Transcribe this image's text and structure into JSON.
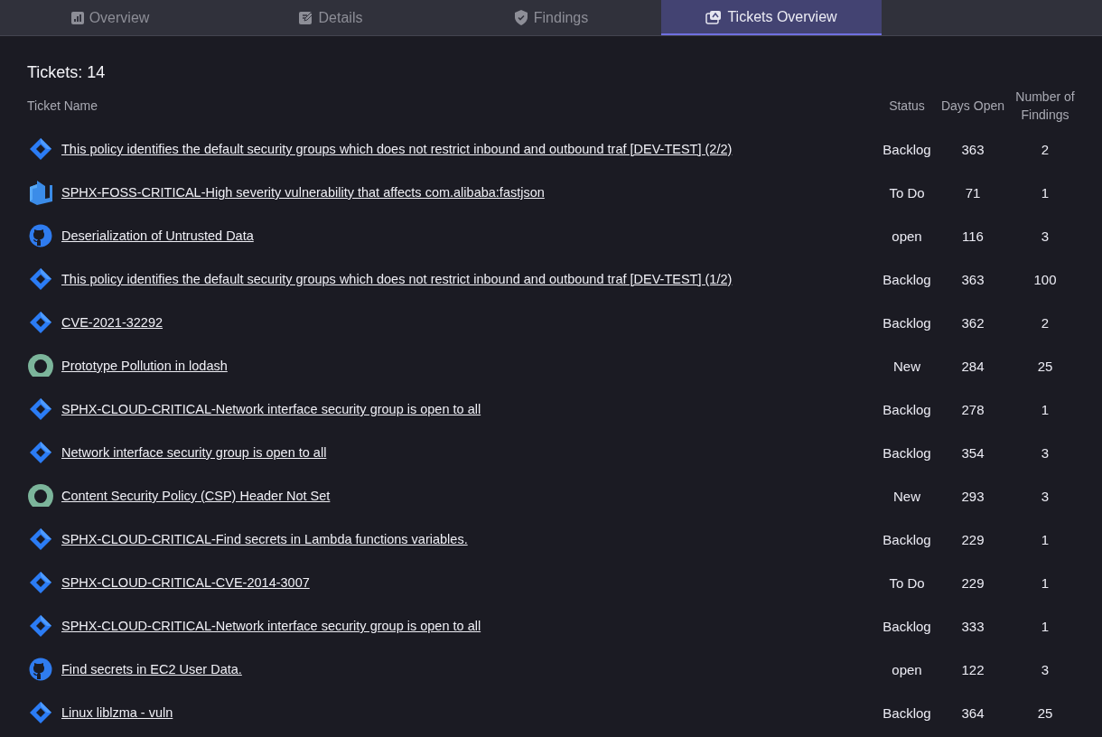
{
  "tabs": [
    {
      "label": "Overview",
      "kind": "chart",
      "selected": false
    },
    {
      "label": "Details",
      "kind": "edit",
      "selected": false
    },
    {
      "label": "Findings",
      "kind": "shield",
      "selected": false
    },
    {
      "label": "Tickets Overview",
      "kind": "tickets",
      "selected": true
    }
  ],
  "title": "Tickets: 14",
  "table": {
    "columns": [
      "Ticket Name",
      "Status",
      "Days Open",
      "Number of Findings"
    ],
    "rows": [
      {
        "kind": "diamond",
        "name": "This policy identifies the default security groups which does not restrict inbound and outbound traf [DEV-TEST] (2/2)",
        "status": "Backlog",
        "days_open": "363",
        "findings": "2"
      },
      {
        "kind": "azure",
        "name": "SPHX-FOSS-CRITICAL-High severity vulnerability that affects com.alibaba:fastjson",
        "status": "To Do",
        "days_open": "71",
        "findings": "1"
      },
      {
        "kind": "github",
        "name": "Deserialization of Untrusted Data",
        "status": "open",
        "days_open": "116",
        "findings": "3"
      },
      {
        "kind": "diamond",
        "name": "This policy identifies the default security groups which does not restrict inbound and outbound traf [DEV-TEST] (1/2)",
        "status": "Backlog",
        "days_open": "363",
        "findings": "100"
      },
      {
        "kind": "diamond",
        "name": "CVE-2021-32292",
        "status": "Backlog",
        "days_open": "362",
        "findings": "2"
      },
      {
        "kind": "ring",
        "name": "Prototype Pollution in lodash",
        "status": "New",
        "days_open": "284",
        "findings": "25"
      },
      {
        "kind": "diamond",
        "name": "SPHX-CLOUD-CRITICAL-Network interface security group is open to all",
        "status": "Backlog",
        "days_open": "278",
        "findings": "1"
      },
      {
        "kind": "diamond",
        "name": "Network interface security group is open to all",
        "status": "Backlog",
        "days_open": "354",
        "findings": "3"
      },
      {
        "kind": "ring",
        "name": "Content Security Policy (CSP) Header Not Set",
        "status": "New",
        "days_open": "293",
        "findings": "3"
      },
      {
        "kind": "diamond",
        "name": "SPHX-CLOUD-CRITICAL-Find secrets in Lambda functions variables.",
        "status": "Backlog",
        "days_open": "229",
        "findings": "1"
      },
      {
        "kind": "diamond",
        "name": "SPHX-CLOUD-CRITICAL-CVE-2014-3007",
        "status": "To Do",
        "days_open": "229",
        "findings": "1"
      },
      {
        "kind": "diamond",
        "name": "SPHX-CLOUD-CRITICAL-Network interface security group is open to all",
        "status": "Backlog",
        "days_open": "333",
        "findings": "1"
      },
      {
        "kind": "github",
        "name": "Find secrets in EC2 User Data.",
        "status": "open",
        "days_open": "122",
        "findings": "3"
      },
      {
        "kind": "diamond",
        "name": "Linux liblzma - vuln",
        "status": "Backlog",
        "days_open": "364",
        "findings": "25"
      }
    ]
  }
}
